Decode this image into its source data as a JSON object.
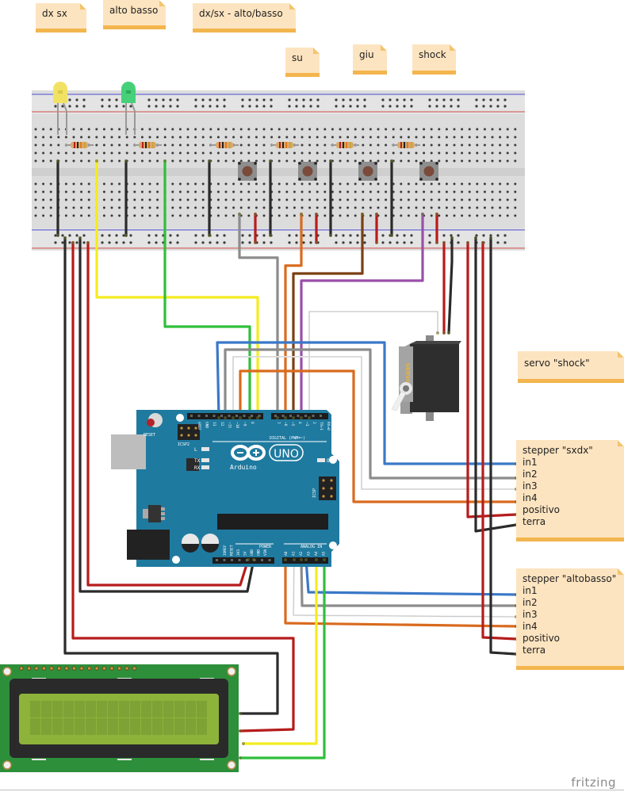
{
  "notes": {
    "dx_sx": "dx sx",
    "alto_basso": "alto basso",
    "dxsx_altobasso": "dx/sx - alto/basso",
    "su": "su",
    "giu": "giu",
    "shock": "shock",
    "servo": "servo \"shock\"",
    "stepper_sxdx": {
      "title": "stepper \"sxdx\"",
      "pins": [
        "in1",
        "in2",
        "in3",
        "in4",
        "positivo",
        "terra"
      ]
    },
    "stepper_altobasso": {
      "title": "stepper \"altobasso\"",
      "pins": [
        "in1",
        "in2",
        "in3",
        "in4",
        "positivo",
        "terra"
      ]
    }
  },
  "components": {
    "leds": [
      {
        "name": "led-dx-sx",
        "color": "#f2e264"
      },
      {
        "name": "led-alto-basso",
        "color": "#46d07a"
      }
    ],
    "pushbuttons": [
      "su",
      "giu",
      "shock",
      "dx/sx - alto/basso"
    ],
    "servo_label": "SERVO",
    "arduino": {
      "model": "UNO",
      "brand": "Arduino",
      "reset_label": "RESET",
      "icsp2_label": "ICSP2",
      "icsp_label": "ICSP",
      "digital_label": "DIGITAL (PWM=~)",
      "power_label": "POWER",
      "analog_label": "ANALOG IN",
      "led_labels": [
        "L",
        "TX",
        "RX",
        "ON"
      ],
      "digital_pins": [
        "AREF",
        "GND",
        "13",
        "12",
        "~11",
        "~10",
        "~9",
        "8",
        "7",
        "~6",
        "~5",
        "4",
        "~3",
        "2",
        "TX▸1",
        "RX◂0"
      ],
      "power_pins": [
        "IOREF",
        "RESET",
        "3V3",
        "5V",
        "GND",
        "GND",
        "VIN"
      ],
      "analog_pins": [
        "A0",
        "A1",
        "A2",
        "A3",
        "A4",
        "A5"
      ]
    }
  },
  "wire_colors": {
    "black": "#2b2b2b",
    "red": "#b61c1c",
    "yellow": "#f4ec1e",
    "green": "#2fbf3b",
    "gray": "#8c8c8c",
    "orange": "#d96a1e",
    "brown": "#7a3f12",
    "purple": "#9a4fa8",
    "white": "#e8e8e8",
    "blue": "#3a78c8"
  },
  "watermark": "fritzing"
}
